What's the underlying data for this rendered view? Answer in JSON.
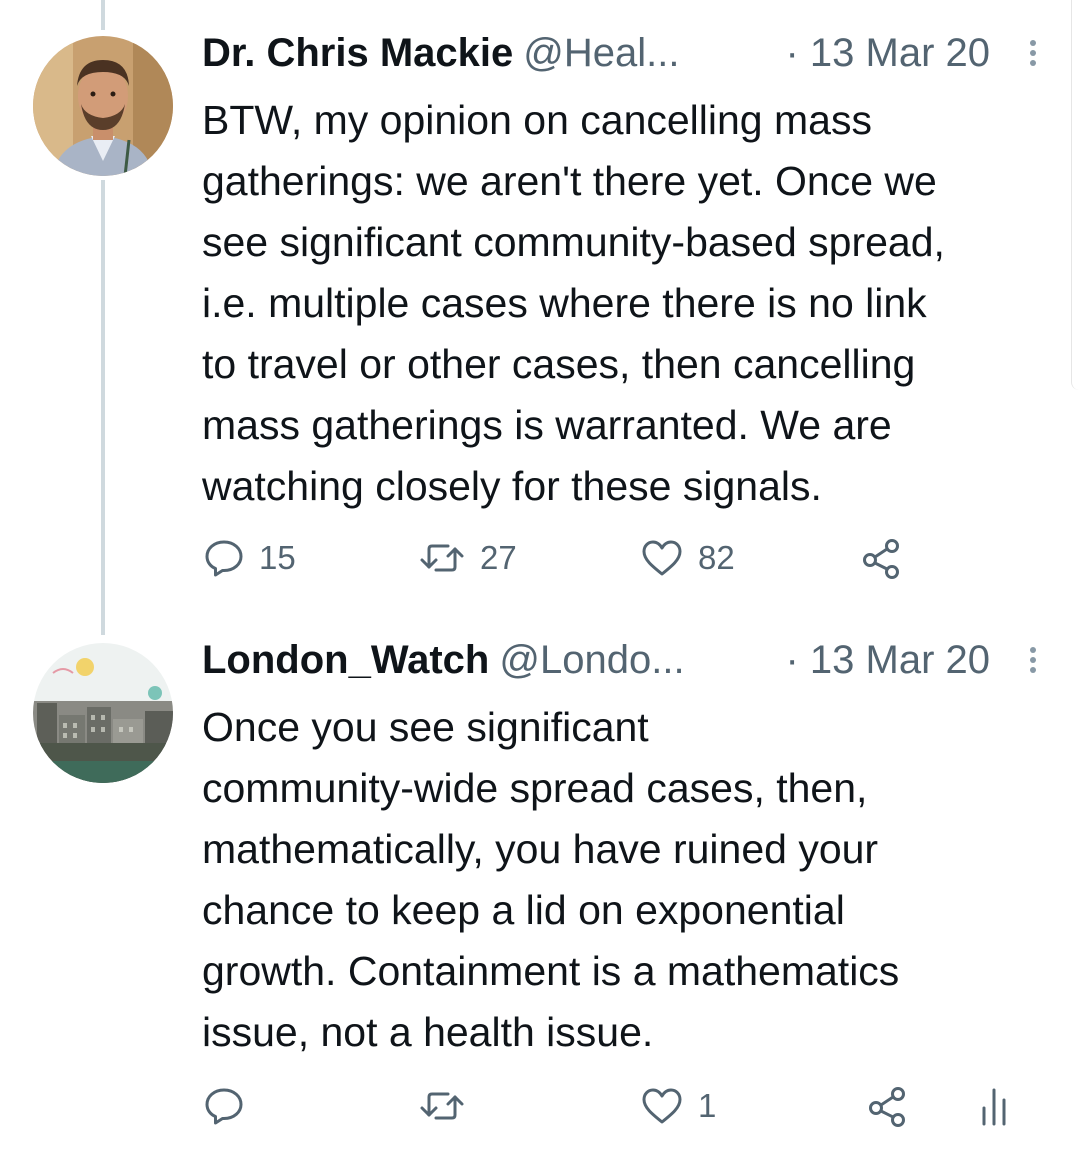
{
  "tweets": [
    {
      "display_name": "Dr. Chris Mackie",
      "handle": "@Heal...",
      "date": "· 13 Mar 20",
      "avatar_icon": "person-photo-avatar",
      "text": "BTW, my opinion on cancelling mass\ngatherings: we aren't there yet. Once we\nsee significant community-based spread,\ni.e. multiple cases where there is no link\nto travel or other cases, then cancelling\nmass gatherings is warranted. We are\nwatching closely for these signals.",
      "actions": {
        "reply_count": "15",
        "retweet_count": "27",
        "like_count": "82"
      }
    },
    {
      "display_name": "London_Watch",
      "handle": "@Londo...",
      "date": "· 13 Mar 20",
      "avatar_icon": "city-skyline-avatar",
      "text": "Once you see significant\ncommunity-wide spread cases, then,\nmathematically, you have ruined your\nchance to keep a lid on exponential\ngrowth. Containment is a mathematics\nissue, not a health issue.",
      "actions": {
        "reply_count": "",
        "retweet_count": "",
        "like_count": "1"
      }
    }
  ],
  "icons": {
    "reply": "speech-bubble-icon",
    "retweet": "retweet-arrows-icon",
    "like": "heart-icon",
    "share": "share-icon",
    "analytics": "analytics-bars-icon",
    "more": "more-vertical-icon"
  },
  "colors": {
    "text_primary": "#0f1419",
    "text_secondary": "#536471",
    "thread_line": "#cfd9de"
  }
}
